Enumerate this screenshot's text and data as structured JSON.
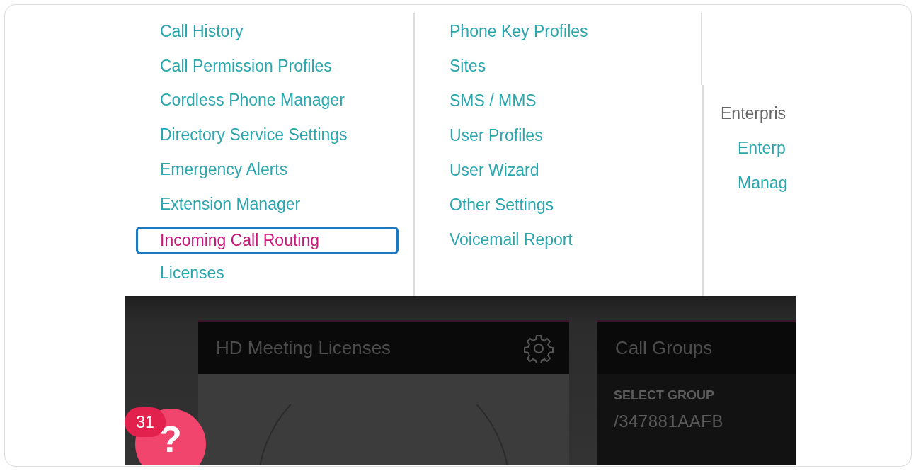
{
  "menu": {
    "columns": [
      {
        "items": [
          {
            "label": "Call History",
            "selected": false
          },
          {
            "label": "Call Permission Profiles",
            "selected": false
          },
          {
            "label": "Cordless Phone Manager",
            "selected": false
          },
          {
            "label": "Directory Service Settings",
            "selected": false
          },
          {
            "label": "Emergency Alerts",
            "selected": false
          },
          {
            "label": "Extension Manager",
            "selected": false
          },
          {
            "label": "Incoming Call Routing",
            "selected": true
          },
          {
            "label": "Licenses",
            "selected": false
          }
        ]
      },
      {
        "items": [
          {
            "label": "Phone Key Profiles",
            "selected": false
          },
          {
            "label": "Sites",
            "selected": false
          },
          {
            "label": "SMS / MMS",
            "selected": false
          },
          {
            "label": "User Profiles",
            "selected": false
          },
          {
            "label": "User Wizard",
            "selected": false
          },
          {
            "label": "Other Settings",
            "selected": false
          },
          {
            "label": "Voicemail Report",
            "selected": false
          }
        ]
      }
    ],
    "partial_column": {
      "heading": "Enterpris",
      "items": [
        "Enterp",
        "Manag"
      ]
    }
  },
  "dashboard": {
    "cards": [
      {
        "kind": "licenses",
        "title": "HD Meeting Licenses"
      },
      {
        "kind": "groups",
        "title": "Call Groups",
        "field_label": "SELECT GROUP",
        "field_value": "/347881AAFB"
      }
    ]
  },
  "help": {
    "badge": "31",
    "icon": "?"
  }
}
